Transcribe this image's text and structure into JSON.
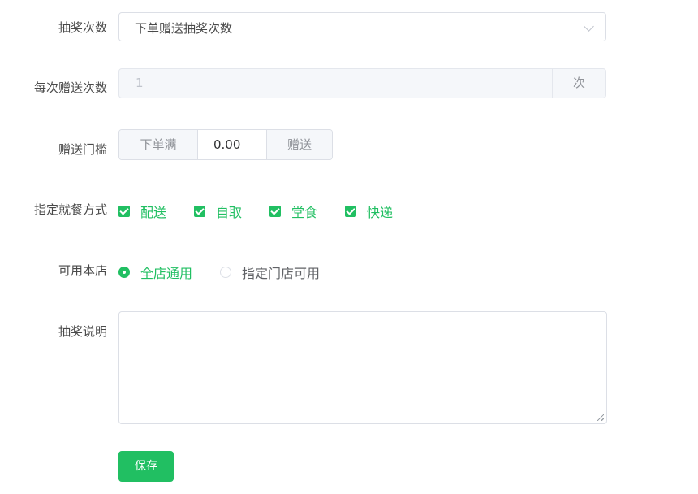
{
  "labels": {
    "draw_count": "抽奖次数",
    "gift_count": "每次赠送次数",
    "threshold": "赠送门槛",
    "dining": "指定就餐方式",
    "store": "可用本店",
    "desc": "抽奖说明"
  },
  "draw_count_select": {
    "value": "下单赠送抽奖次数"
  },
  "gift_count_input": {
    "value": "1",
    "suffix": "次"
  },
  "threshold_input": {
    "prepend": "下单满",
    "value": "0.00",
    "append": "赠送"
  },
  "dining_options": [
    {
      "label": "配送",
      "checked": true
    },
    {
      "label": "自取",
      "checked": true
    },
    {
      "label": "堂食",
      "checked": true
    },
    {
      "label": "快递",
      "checked": true
    }
  ],
  "store_options": [
    {
      "label": "全店通用",
      "selected": true
    },
    {
      "label": "指定门店可用",
      "selected": false
    }
  ],
  "description": {
    "value": ""
  },
  "save_label": "保存",
  "colors": {
    "accent": "#21bf62"
  }
}
